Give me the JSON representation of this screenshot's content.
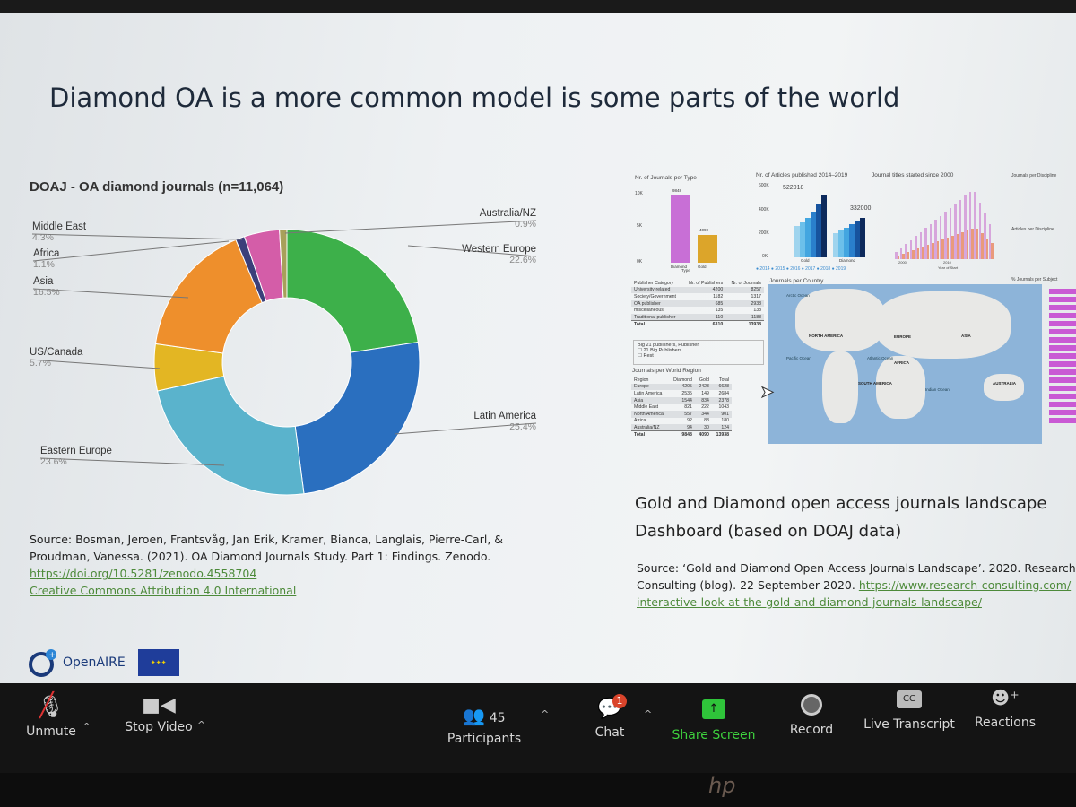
{
  "slide": {
    "title": "Diamond OA is a more common model is some parts of the world",
    "chart_data": {
      "type": "pie",
      "title": "DOAJ - OA diamond journals (n=11,064)",
      "donut": true,
      "categories": [
        "Western Europe",
        "Latin America",
        "Eastern Europe",
        "US/Canada",
        "Asia",
        "Africa",
        "Middle East",
        "Australia/NZ"
      ],
      "values": [
        22.6,
        25.4,
        23.6,
        5.7,
        16.5,
        1.1,
        4.3,
        0.9
      ],
      "labels": [
        "22.6%",
        "25.4%",
        "23.6%",
        "5.7%",
        "16.5%",
        "1.1%",
        "4.3%",
        "0.9%"
      ],
      "colors": [
        "#3db04a",
        "#2a6fbf",
        "#5ab3cc",
        "#e3b623",
        "#ee8f2c",
        "#3b3f7a",
        "#d45da8",
        "#a8a05a"
      ]
    },
    "source_left": {
      "text": "Source: Bosman, Jeroen, Frantsvåg, Jan Erik, Kramer, Bianca, Langlais, Pierre-Carl, & Proudman, Vanessa. (2021). OA Diamond Journals Study. Part 1: Findings. Zenodo.",
      "doi": "https://doi.org/10.5281/zenodo.4558704",
      "license": "Creative Commons Attribution 4.0 International"
    },
    "dashboard": {
      "types_title": "Nr. of Journals per Type",
      "types": [
        {
          "label": "Diamond",
          "value": 9848,
          "display": "9848",
          "color": "#c86fd6"
        },
        {
          "label": "Gold",
          "value": 4090,
          "display": "4090",
          "color": "#dca52a"
        }
      ],
      "types_axis": [
        "10K",
        "5K",
        "0K"
      ],
      "types_xlabel": "Type",
      "articles_title": "Nr. of Articles published 2014–2019",
      "articles_gold_total": "522018",
      "articles_diamond_total": "332000",
      "articles_axis": [
        "600K",
        "400K",
        "200K",
        "0K"
      ],
      "articles_groups": [
        "Gold",
        "Diamond"
      ],
      "articles_legend": [
        "2014",
        "2015",
        "2016",
        "2017",
        "2018",
        "2019"
      ],
      "started_title": "Journal titles started since 2000",
      "started_axis_x": [
        "2000",
        "2010"
      ],
      "started_xlabel": "Year of Start",
      "publisher_headers": [
        "Publisher Category",
        "Nr. of Publishers",
        "Nr. of Journals"
      ],
      "publisher_rows": [
        [
          "University-related",
          "4200",
          "8257"
        ],
        [
          "Society/Government",
          "1182",
          "1317"
        ],
        [
          "OA publisher",
          "685",
          "2938"
        ],
        [
          "miscellaneous",
          "135",
          "138"
        ],
        [
          "Traditional publisher",
          "110",
          "1188"
        ]
      ],
      "publisher_total": [
        "Total",
        "6310",
        "13938"
      ],
      "big21_title": "Big 21 publishers, Publisher",
      "big21_options": [
        "21 Big Publishers",
        "Rest"
      ],
      "region_title": "Journals per World Region",
      "region_headers": [
        "Region",
        "Diamond",
        "Gold",
        "Total"
      ],
      "region_rows": [
        [
          "Europe",
          "4205",
          "2423",
          "6628"
        ],
        [
          "Latin America",
          "2535",
          "149",
          "2684"
        ],
        [
          "Asia",
          "1544",
          "834",
          "2378"
        ],
        [
          "Middle East",
          "821",
          "222",
          "1043"
        ],
        [
          "North America",
          "557",
          "344",
          "901"
        ],
        [
          "Africa",
          "92",
          "88",
          "180"
        ],
        [
          "Australia/NZ",
          "94",
          "30",
          "124"
        ]
      ],
      "region_total": [
        "Total",
        "9848",
        "4090",
        "13938"
      ],
      "map_title": "Journals per Country",
      "map_labels": [
        "NORTH AMERICA",
        "EUROPE",
        "ASIA",
        "AFRICA",
        "SOUTH AMERICA",
        "AUSTRALIA",
        "Pacific Ocean",
        "Atlantic Ocean",
        "Indian Ocean",
        "Arctic Ocean"
      ],
      "discipline_title": "Journals per Discipline",
      "articles_discipline_title": "Articles per Discipline",
      "subject_title": "% Journals per Subject"
    },
    "caption": [
      "Gold and Diamond open access journals landscape",
      "Dashboard (based on DOAJ data)"
    ],
    "source_right": {
      "line1": "Source: ‘Gold and Diamond Open Access Journals Landscape’. 2020. Research",
      "line2": "Consulting (blog). 22 September 2020.",
      "link1": "https://www.research-consulting.com/",
      "link2": "interactive-look-at-the-gold-and-diamond-journals-landscape/"
    },
    "logo": "OpenAIRE"
  },
  "toolbar": {
    "unmute": "Unmute",
    "stop_video": "Stop Video",
    "participants": "Participants",
    "participants_count": "45",
    "chat": "Chat",
    "chat_badge": "1",
    "share": "Share Screen",
    "record": "Record",
    "transcript": "Live Transcript",
    "cc": "CC",
    "reactions": "Reactions"
  },
  "bezel_logo": "hp",
  "colors": {
    "share": "#3ed13e",
    "badge": "#d9442b"
  }
}
